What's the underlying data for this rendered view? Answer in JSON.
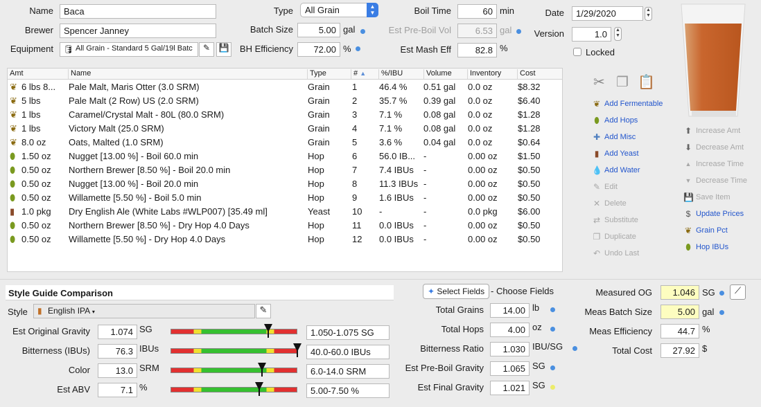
{
  "recipe": {
    "name_label": "Name",
    "name": "Baca",
    "brewer_label": "Brewer",
    "brewer": "Spencer Janney",
    "equipment_label": "Equipment",
    "equipment": "All Grain - Standard 5 Gal/19l Batc",
    "type_label": "Type",
    "type": "All Grain",
    "batch_size_label": "Batch Size",
    "batch_size": "5.00",
    "batch_size_unit": "gal",
    "bh_eff_label": "BH Efficiency",
    "bh_eff": "72.00",
    "bh_eff_unit": "%",
    "boil_time_label": "Boil Time",
    "boil_time": "60",
    "boil_time_unit": "min",
    "pre_boil_label": "Est Pre-Boil Vol",
    "pre_boil": "6.53",
    "pre_boil_unit": "gal",
    "mash_eff_label": "Est Mash Eff",
    "mash_eff": "82.8",
    "mash_eff_unit": "%",
    "date_label": "Date",
    "date": "1/29/2020",
    "version_label": "Version",
    "version": "1.0",
    "locked_label": "Locked"
  },
  "table": {
    "headers": [
      "Amt",
      "Name",
      "Type",
      "#",
      "%/IBU",
      "Volume",
      "Inventory",
      "Cost"
    ],
    "rows": [
      {
        "amt": "6 lbs 8...",
        "name": "Pale Malt, Maris Otter (3.0 SRM)",
        "type": "Grain",
        "num": "1",
        "ibu": "46.4 %",
        "vol": "0.51 gal",
        "inv": "0.0 oz",
        "cost": "$8.32",
        "icon": "grain-icon"
      },
      {
        "amt": "5 lbs",
        "name": "Pale Malt (2 Row) US (2.0 SRM)",
        "type": "Grain",
        "num": "2",
        "ibu": "35.7 %",
        "vol": "0.39 gal",
        "inv": "0.0 oz",
        "cost": "$6.40",
        "icon": "grain-icon"
      },
      {
        "amt": "1 lbs",
        "name": "Caramel/Crystal Malt - 80L (80.0 SRM)",
        "type": "Grain",
        "num": "3",
        "ibu": "7.1 %",
        "vol": "0.08 gal",
        "inv": "0.0 oz",
        "cost": "$1.28",
        "icon": "grain-icon"
      },
      {
        "amt": "1 lbs",
        "name": "Victory Malt (25.0 SRM)",
        "type": "Grain",
        "num": "4",
        "ibu": "7.1 %",
        "vol": "0.08 gal",
        "inv": "0.0 oz",
        "cost": "$1.28",
        "icon": "grain-icon"
      },
      {
        "amt": "8.0 oz",
        "name": "Oats, Malted (1.0 SRM)",
        "type": "Grain",
        "num": "5",
        "ibu": "3.6 %",
        "vol": "0.04 gal",
        "inv": "0.0 oz",
        "cost": "$0.64",
        "icon": "grain-icon"
      },
      {
        "amt": "1.50 oz",
        "name": "Nugget [13.00 %] - Boil 60.0 min",
        "type": "Hop",
        "num": "6",
        "ibu": "56.0 IB...",
        "vol": "-",
        "inv": "0.00 oz",
        "cost": "$1.50",
        "icon": "hop-icon"
      },
      {
        "amt": "0.50 oz",
        "name": "Northern Brewer [8.50 %] - Boil 20.0 min",
        "type": "Hop",
        "num": "7",
        "ibu": "7.4 IBUs",
        "vol": "-",
        "inv": "0.00 oz",
        "cost": "$0.50",
        "icon": "hop-icon"
      },
      {
        "amt": "0.50 oz",
        "name": "Nugget [13.00 %] - Boil 20.0 min",
        "type": "Hop",
        "num": "8",
        "ibu": "11.3 IBUs",
        "vol": "-",
        "inv": "0.00 oz",
        "cost": "$0.50",
        "icon": "hop-icon"
      },
      {
        "amt": "0.50 oz",
        "name": "Willamette [5.50 %] - Boil 5.0 min",
        "type": "Hop",
        "num": "9",
        "ibu": "1.6 IBUs",
        "vol": "-",
        "inv": "0.00 oz",
        "cost": "$0.50",
        "icon": "hop-icon"
      },
      {
        "amt": "1.0 pkg",
        "name": "Dry English Ale (White Labs #WLP007) [35.49 ml]",
        "type": "Yeast",
        "num": "10",
        "ibu": "-",
        "vol": "-",
        "inv": "0.0 pkg",
        "cost": "$6.00",
        "icon": "yeast-icon"
      },
      {
        "amt": "0.50 oz",
        "name": "Northern Brewer [8.50 %] - Dry Hop 4.0 Days",
        "type": "Hop",
        "num": "11",
        "ibu": "0.0 IBUs",
        "vol": "-",
        "inv": "0.00 oz",
        "cost": "$0.50",
        "icon": "hop-icon"
      },
      {
        "amt": "0.50 oz",
        "name": "Willamette [5.50 %] - Dry Hop 4.0 Days",
        "type": "Hop",
        "num": "12",
        "ibu": "0.0 IBUs",
        "vol": "-",
        "inv": "0.00 oz",
        "cost": "$0.50",
        "icon": "hop-icon"
      }
    ]
  },
  "actions": {
    "add_fermentable": "Add Fermentable",
    "add_hops": "Add Hops",
    "add_misc": "Add Misc",
    "add_yeast": "Add Yeast",
    "add_water": "Add Water",
    "edit": "Edit",
    "delete": "Delete",
    "substitute": "Substitute",
    "duplicate": "Duplicate",
    "undo_last": "Undo Last",
    "increase_amt": "Increase Amt",
    "decrease_amt": "Decrease Amt",
    "increase_time": "Increase Time",
    "decrease_time": "Decrease Time",
    "save_item": "Save Item",
    "update_prices": "Update Prices",
    "grain_pct": "Grain Pct",
    "hop_ibus": "Hop IBUs"
  },
  "style": {
    "section_title": "Style Guide Comparison",
    "style_label": "Style",
    "style_value": "English IPA",
    "metrics": [
      {
        "label": "Est Original Gravity",
        "value": "1.074",
        "unit": "SG",
        "range": "1.050-1.075 SG",
        "position": 0.77
      },
      {
        "label": "Bitterness (IBUs)",
        "value": "76.3",
        "unit": "IBUs",
        "range": "40.0-60.0 IBUs",
        "position": 1.0
      },
      {
        "label": "Color",
        "value": "13.0",
        "unit": "SRM",
        "range": "6.0-14.0 SRM",
        "position": 0.72
      },
      {
        "label": "Est ABV",
        "value": "7.1",
        "unit": "%",
        "range": "5.00-7.50 %",
        "position": 0.7
      }
    ]
  },
  "fields": {
    "select_button": "Select Fields",
    "choose_label": "- Choose Fields",
    "items": [
      {
        "label": "Total Grains",
        "value": "14.00",
        "unit": "lb"
      },
      {
        "label": "Total Hops",
        "value": "4.00",
        "unit": "oz"
      },
      {
        "label": "Bitterness Ratio",
        "value": "1.030",
        "unit": "IBU/SG"
      },
      {
        "label": "Est Pre-Boil Gravity",
        "value": "1.065",
        "unit": "SG"
      },
      {
        "label": "Est Final Gravity",
        "value": "1.021",
        "unit": "SG"
      }
    ]
  },
  "measured": {
    "og_label": "Measured OG",
    "og": "1.046",
    "og_unit": "SG",
    "batch_label": "Meas Batch Size",
    "batch": "5.00",
    "batch_unit": "gal",
    "eff_label": "Meas Efficiency",
    "eff": "44.7",
    "eff_unit": "%",
    "cost_label": "Total Cost",
    "cost": "27.92",
    "cost_unit": "$"
  },
  "colors": {
    "beer": "#c9662e",
    "accent": "#2255cc",
    "highlight": "#fdfdc0"
  }
}
